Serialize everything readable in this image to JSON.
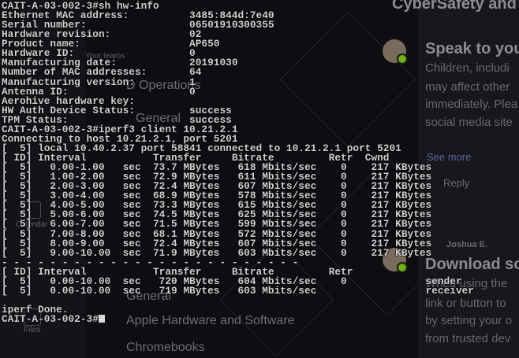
{
  "background": {
    "top_right_title": "CyberSafety and",
    "sidebar_items": [
      "Your teams",
      "Calendar",
      "Files"
    ],
    "middle_items": [
      "D Operations",
      "General",
      "General",
      "Apple Hardware and Software",
      "Chromebooks"
    ],
    "right_panel": {
      "speak_title": "Speak to you",
      "speak_body": [
        "Children, includi",
        "may affect other",
        "immediately. Plea",
        "social media site"
      ],
      "see_more": "See more",
      "reply": "Reply",
      "author": "Joshua E.",
      "download_title": "Download so",
      "download_body": [
        "When using the",
        "link or button to",
        "by setting your o",
        "from trusted dev"
      ]
    }
  },
  "terminal": {
    "lines": [
      "CAIT-A-03-002-3#sh hw-info",
      "Ethernet MAC address:          3485:844d:7e40",
      "Serial number:                 06501910300355",
      "Hardware revision:             02",
      "Product name:                  AP650",
      "Hardware ID:                   0",
      "Manufacturing date:            20191030",
      "Number of MAC addresses:       64",
      "Manufacturing version:         1",
      "Antenna ID:                    0",
      "Aerohive hardware key:",
      "HW Auth Device Status:         success",
      "TPM Status:                    success",
      "CAIT-A-03-002-3#iperf3 client 10.21.2.1",
      "Connecting to host 10.21.2.1, port 5201",
      "[  5] local 10.40.2.37 port 58841 connected to 10.21.2.1 port 5201",
      "[ ID] Interval           Transfer     Bitrate         Retr  Cwnd",
      "[  5]   0.00-1.00   sec  73.7 MBytes   618 Mbits/sec    0    217 KBytes",
      "[  5]   1.00-2.00   sec  72.9 MBytes   611 Mbits/sec    0    217 KBytes",
      "[  5]   2.00-3.00   sec  72.4 MBytes   607 Mbits/sec    0    217 KBytes",
      "[  5]   3.00-4.00   sec  68.9 MBytes   578 Mbits/sec    0    217 KBytes",
      "[  5]   4.00-5.00   sec  73.3 MBytes   615 Mbits/sec    0    217 KBytes",
      "[  5]   5.00-6.00   sec  74.5 MBytes   625 Mbits/sec    0    217 KBytes",
      "[  5]   6.00-7.00   sec  71.5 MBytes   599 Mbits/sec    0    217 KBytes",
      "[  5]   7.00-8.00   sec  68.1 MBytes   572 Mbits/sec    0    217 KBytes",
      "[  5]   8.00-9.00   sec  72.4 MBytes   607 Mbits/sec    0    217 KBytes",
      "[  5]   9.00-10.00  sec  71.9 MBytes   603 Mbits/sec    0    217 KBytes",
      "- - - - - - - - - - - - - - - - - - - - - - - - -",
      "[ ID] Interval           Transfer     Bitrate         Retr",
      "[  5]   0.00-10.00  sec   720 MBytes   604 Mbits/sec    0             sender",
      "[  5]   0.00-10.00  sec   719 MBytes   603 Mbits/sec                  receiver",
      "",
      "iperf Done.",
      "CAIT-A-03-002-3#"
    ]
  }
}
